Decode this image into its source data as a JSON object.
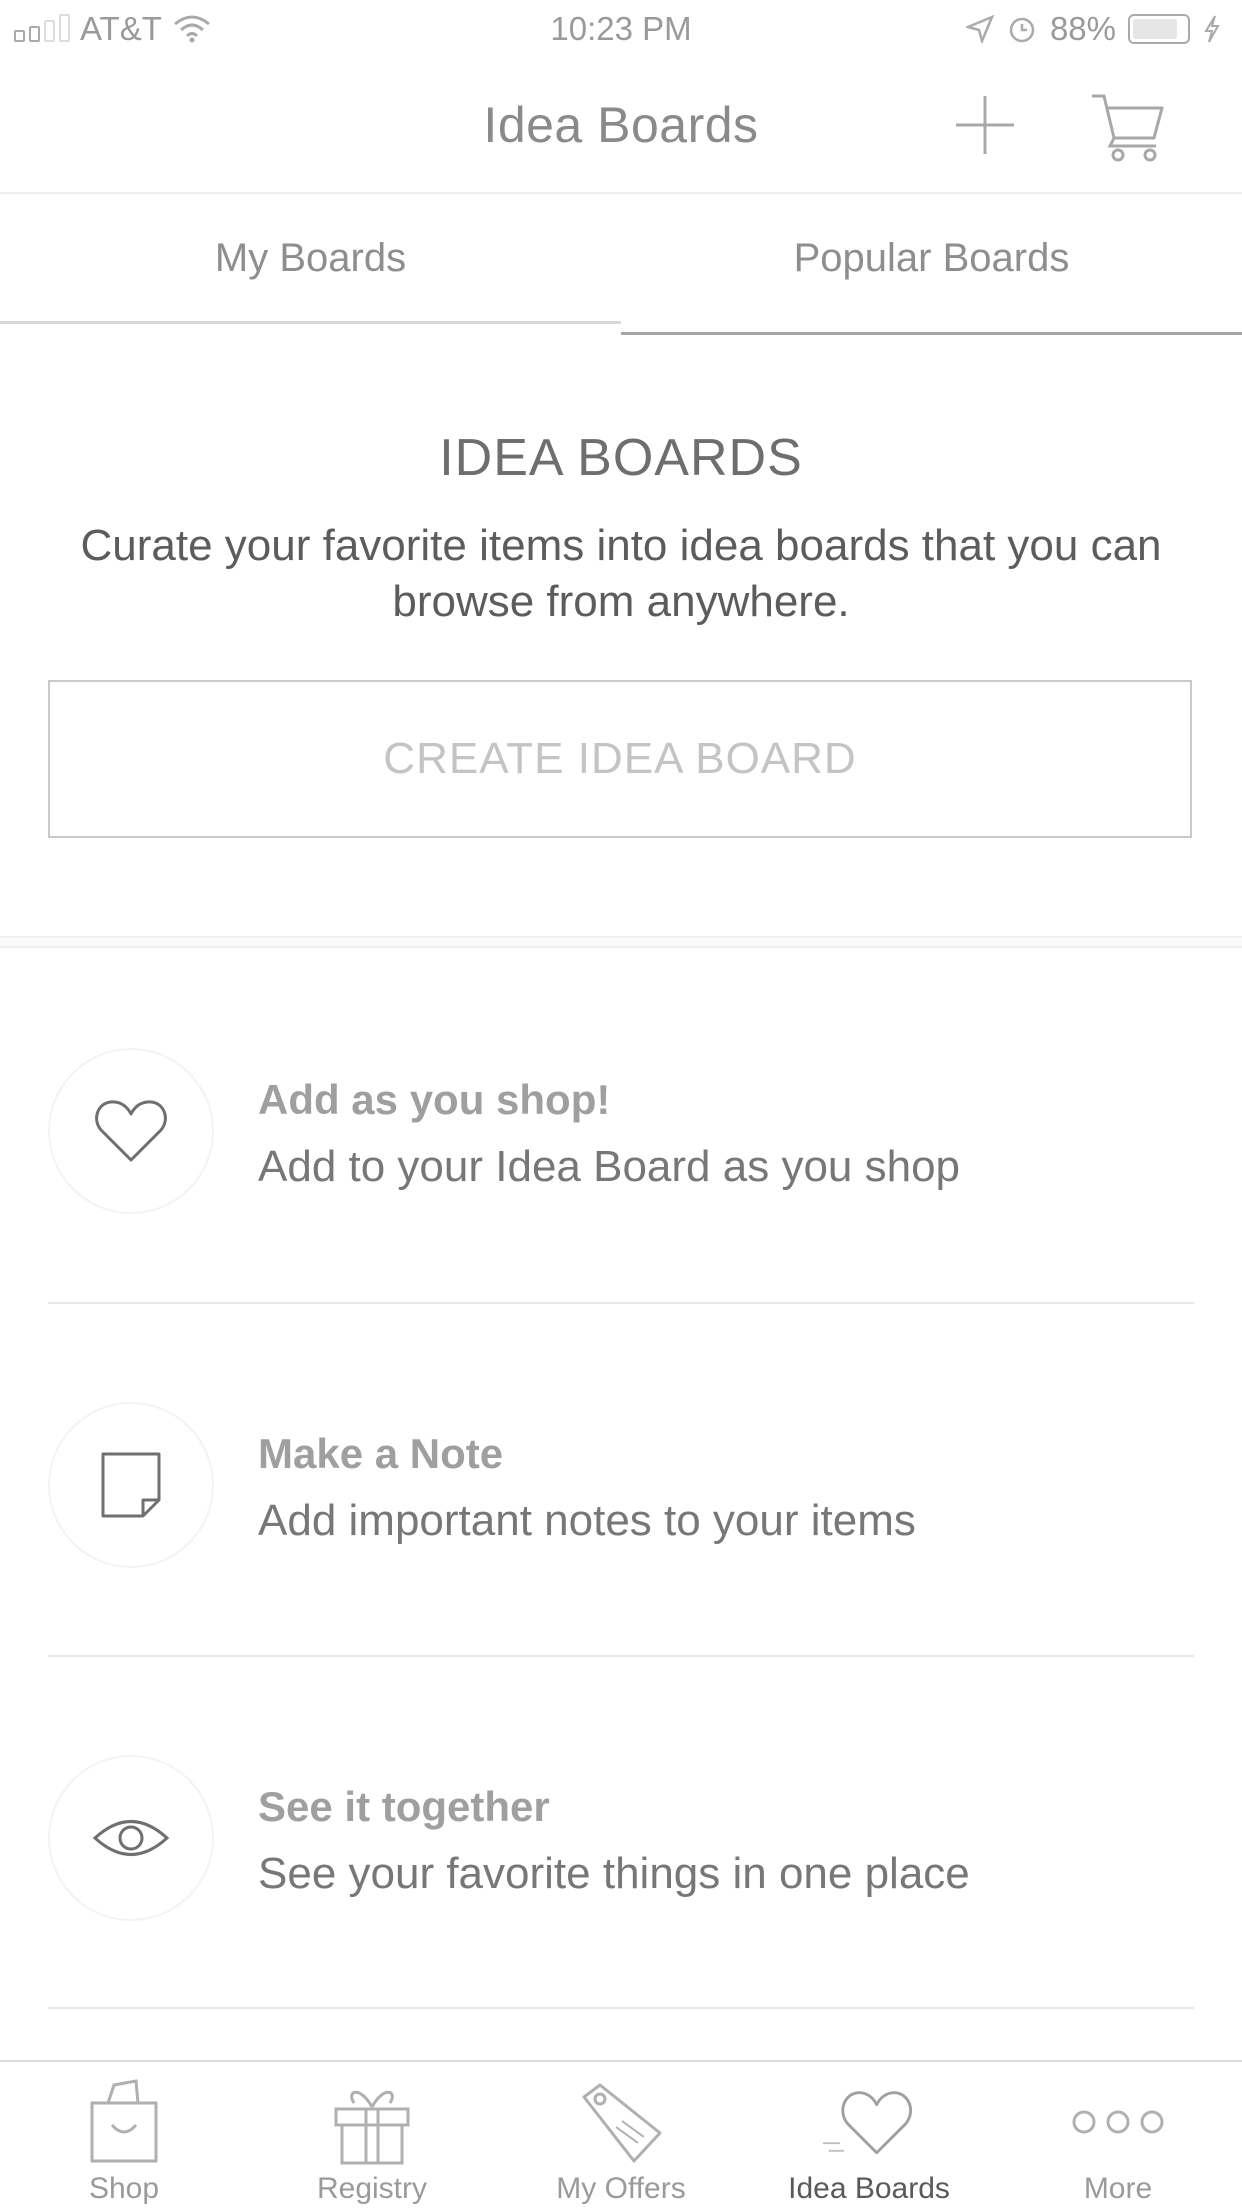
{
  "status_bar": {
    "carrier": "AT&T",
    "time": "10:23 PM",
    "battery": "88%"
  },
  "nav": {
    "title": "Idea Boards"
  },
  "tabs": [
    {
      "label": "My Boards",
      "active": true
    },
    {
      "label": "Popular Boards",
      "active": false
    }
  ],
  "intro": {
    "title": "IDEA BOARDS",
    "description": "Curate your favorite items into idea boards that you can browse from anywhere.",
    "button_label": "CREATE IDEA BOARD"
  },
  "features": [
    {
      "icon": "heart-icon",
      "title": "Add as you shop!",
      "description": "Add to your Idea Board as you shop"
    },
    {
      "icon": "note-icon",
      "title": "Make a Note",
      "description": "Add important notes to your items"
    },
    {
      "icon": "eye-icon",
      "title": "See it together",
      "description": "See your favorite things in one place"
    }
  ],
  "tab_bar": {
    "items": [
      {
        "label": "Shop",
        "icon": "shopping-bag-icon"
      },
      {
        "label": "Registry",
        "icon": "gift-icon"
      },
      {
        "label": "My Offers",
        "icon": "tag-icon"
      },
      {
        "label": "Idea Boards",
        "icon": "heart-icon",
        "active": true
      },
      {
        "label": "More",
        "icon": "more-dots-icon"
      }
    ]
  }
}
